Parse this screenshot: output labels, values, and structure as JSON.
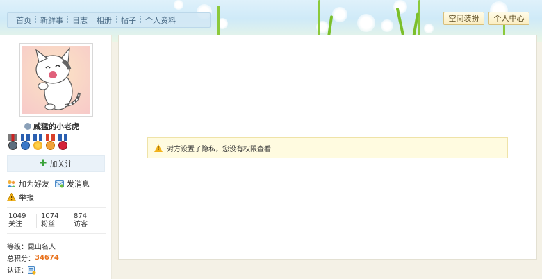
{
  "nav": {
    "items": [
      {
        "label": "首页"
      },
      {
        "label": "新鲜事"
      },
      {
        "label": "日志"
      },
      {
        "label": "相册"
      },
      {
        "label": "帖子"
      },
      {
        "label": "个人资料"
      }
    ]
  },
  "top_buttons": {
    "decorate": "空间装扮",
    "personal_center": "个人中心"
  },
  "profile": {
    "username": "威猛的小老虎",
    "follow_label": "加关注",
    "add_friend": "加为好友",
    "send_message": "发消息",
    "report": "举报",
    "stats": [
      {
        "value": "1049",
        "label": "关注"
      },
      {
        "value": "1074",
        "label": "粉丝"
      },
      {
        "value": "874",
        "label": "访客"
      }
    ],
    "level_label": "等级：",
    "level_value": "昆山名人",
    "points_label": "总积分：",
    "points_value": "34674",
    "verify_label": "认证："
  },
  "notice": {
    "text": "对方设置了隐私，您没有权限查看"
  },
  "colors": {
    "accent_orange": "#e8701a",
    "notice_bg": "#fffbe0",
    "nav_text": "#4a6b86",
    "warning": "#f2b21b"
  }
}
